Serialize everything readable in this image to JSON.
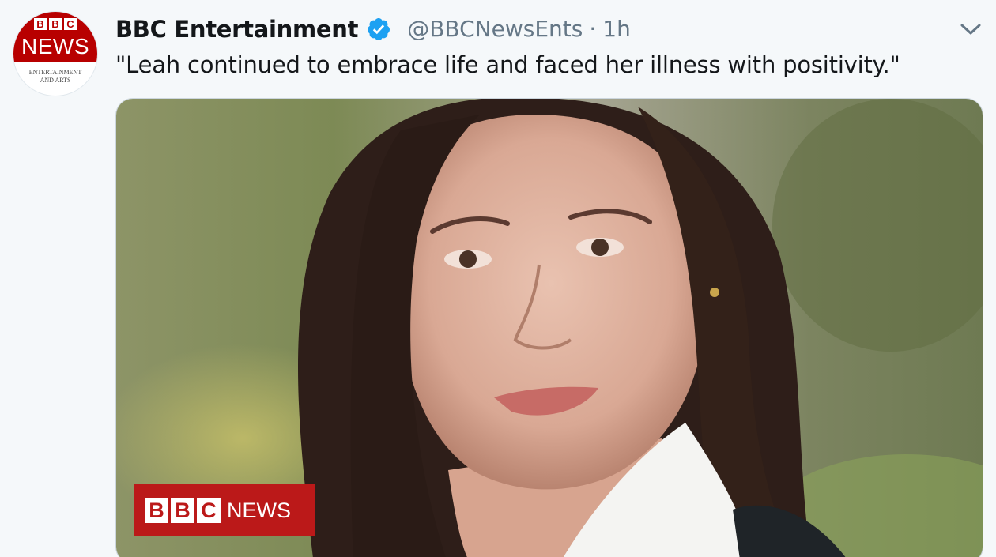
{
  "account": {
    "display_name": "BBC Entertainment",
    "handle": "@BBCNewsEnts",
    "separator": "·",
    "time": "1h",
    "verified": true,
    "avatar": {
      "blocks": [
        "B",
        "B",
        "C"
      ],
      "word": "NEWS",
      "subtitle_line1": "ENTERTAINMENT",
      "subtitle_line2": "AND ARTS"
    }
  },
  "tweet": {
    "text": "\"Leah continued to embrace life and faced her illness with positivity.\""
  },
  "media": {
    "description_icon": "photo",
    "badge": {
      "blocks": [
        "B",
        "B",
        "C"
      ],
      "word": "NEWS"
    }
  },
  "icons": {
    "verified": "verified-badge-icon",
    "caret": "chevron-down-icon"
  },
  "colors": {
    "verified_blue": "#1da1f2",
    "bbc_red": "#bb1919",
    "secondary_text": "#657786",
    "primary_text": "#14171a"
  }
}
